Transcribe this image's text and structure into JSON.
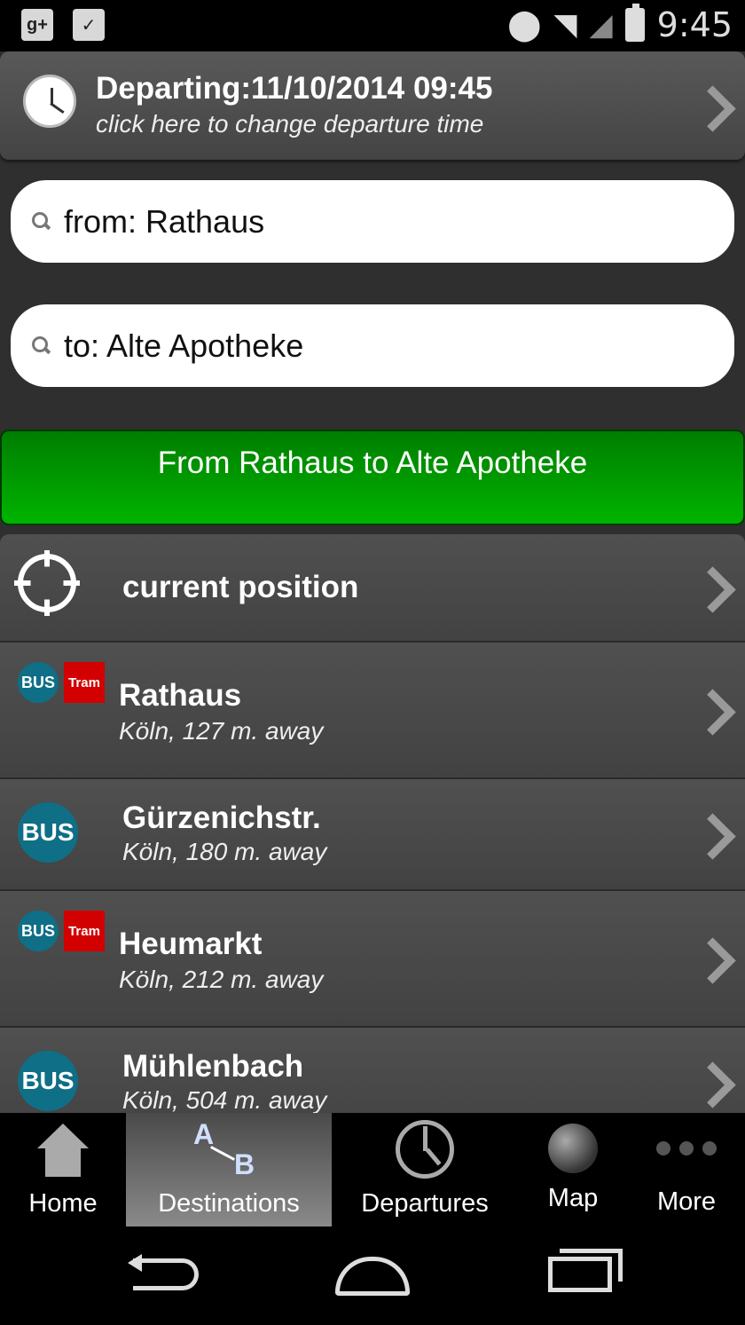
{
  "status_bar": {
    "time": "9:45",
    "left_icons": [
      "google-plus-icon",
      "shopping-bag-check-icon"
    ],
    "right_icons": [
      "location-icon",
      "wifi-icon",
      "cell-signal-icon",
      "battery-icon"
    ]
  },
  "departure": {
    "title": "Departing:11/10/2014 09:45",
    "subtitle": "click here to change departure time"
  },
  "search": {
    "from_value": "from: Rathaus",
    "to_value": "to: Alte Apotheke"
  },
  "route_button": {
    "label": "From Rathaus to Alte Apotheke"
  },
  "list": {
    "current_position": "current position",
    "stops": [
      {
        "name": "Rathaus",
        "distance": "Köln, 127 m. away",
        "modes": [
          "BUS",
          "Tram"
        ]
      },
      {
        "name": "Gürzenichstr.",
        "distance": "Köln, 180 m. away",
        "modes": [
          "BUS"
        ]
      },
      {
        "name": "Heumarkt",
        "distance": "Köln, 212 m. away",
        "modes": [
          "BUS",
          "Tram"
        ]
      },
      {
        "name": "Mühlenbach",
        "distance": "Köln, 504 m. away",
        "modes": [
          "BUS"
        ]
      }
    ],
    "badge_bus": "BUS",
    "badge_tram": "Tram"
  },
  "tabs": {
    "home": "Home",
    "destinations": "Destinations",
    "departures": "Departures",
    "map": "Map",
    "more": "More",
    "active": "destinations",
    "ab_a": "A",
    "ab_b": "B"
  },
  "colors": {
    "route_button": "#00a000",
    "bus_badge": "#0e6f86",
    "tram_badge": "#d20000"
  }
}
